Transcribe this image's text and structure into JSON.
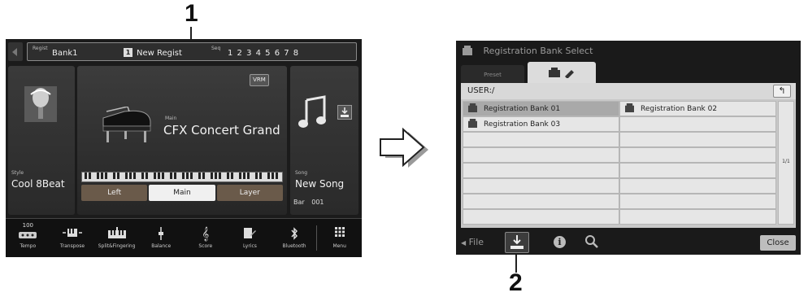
{
  "callouts": {
    "one": "1",
    "two": "2"
  },
  "left_screen": {
    "regist": {
      "regist_small": "Regist",
      "bank": "Bank1",
      "badge": "1",
      "name": "New Regist",
      "seq_small": "Seq",
      "seq_numbers": "1 2 3 4 5 6 7 8"
    },
    "style": {
      "label": "Style",
      "name": "Cool 8Beat"
    },
    "main_voice": {
      "vrm": "VRM",
      "label": "Main",
      "name": "CFX Concert Grand"
    },
    "parts": [
      {
        "label": "Left",
        "selected": false
      },
      {
        "label": "Main",
        "selected": true
      },
      {
        "label": "Layer",
        "selected": false
      }
    ],
    "song": {
      "label": "Song",
      "name": "New Song",
      "bar_label": "Bar",
      "bar_value": "001"
    },
    "bottom_bar": {
      "tempo_value": "100",
      "items": [
        {
          "label": "Tempo",
          "icon": "tempo-icon"
        },
        {
          "label": "Transpose",
          "icon": "transpose-icon"
        },
        {
          "label": "Split&Fingering",
          "icon": "split-icon"
        },
        {
          "label": "Balance",
          "icon": "balance-icon"
        },
        {
          "label": "Score",
          "icon": "score-icon"
        },
        {
          "label": "Lyrics",
          "icon": "lyrics-icon"
        },
        {
          "label": "Bluetooth",
          "icon": "bluetooth-icon"
        },
        {
          "label": "Menu",
          "icon": "menu-icon"
        }
      ]
    }
  },
  "right_screen": {
    "title": "Registration Bank Select",
    "tabs": {
      "preset": "Preset",
      "user_icons": "user-folder-edit-icon"
    },
    "path": "USER:/",
    "banks": [
      {
        "name": "Registration Bank 01",
        "selected": true
      },
      {
        "name": "Registration Bank 02",
        "selected": false
      },
      {
        "name": "Registration Bank 03",
        "selected": false
      }
    ],
    "page": "1/1",
    "footer": {
      "file": "File",
      "close": "Close"
    }
  },
  "colors": {
    "screen_bg": "#1b1b1b",
    "part_tab": "#6a5a4a",
    "list_bg": "#e6e6e6",
    "list_sel": "#a9a9a9"
  }
}
